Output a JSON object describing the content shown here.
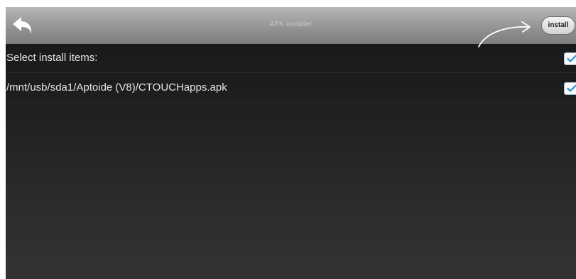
{
  "app": {
    "title": "APK Installer"
  },
  "toolbar": {
    "back_icon": "back-arrow-icon",
    "install_label": "install"
  },
  "list": {
    "header_label": "Select install items:",
    "header_checked": true,
    "items": [
      {
        "label": "/mnt/usb/sda1/Aptoide (V8)/CTOUCHapps.apk",
        "checked": true
      }
    ]
  },
  "colors": {
    "accent_check": "#3a9ad9",
    "titlebar": "#9a9a9a",
    "background": "#1d1d1d",
    "text": "#e4e4e4"
  }
}
